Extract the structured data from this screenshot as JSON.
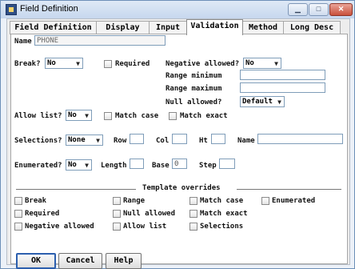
{
  "window": {
    "title": "Field Definition",
    "controls": [
      "minimize",
      "maximize",
      "close"
    ]
  },
  "tabs": [
    "Field Definition",
    "Display",
    "Input",
    "Validation",
    "Method",
    "Long Desc"
  ],
  "active_tab": "Validation",
  "name": {
    "label": "Name",
    "value": "PHONE"
  },
  "break": {
    "label": "Break?",
    "value": "No"
  },
  "required": {
    "label": "Required"
  },
  "negative_allowed": {
    "label": "Negative allowed?",
    "value": "No"
  },
  "range_minimum": {
    "label": "Range minimum",
    "value": ""
  },
  "range_maximum": {
    "label": "Range maximum",
    "value": ""
  },
  "null_allowed": {
    "label": "Null allowed?",
    "value": "Default"
  },
  "allow_list": {
    "label": "Allow list?",
    "value": "No"
  },
  "match_case": {
    "label": "Match case"
  },
  "match_exact": {
    "label": "Match exact"
  },
  "selections": {
    "label": "Selections?",
    "value": "None"
  },
  "row": {
    "label": "Row",
    "value": ""
  },
  "col": {
    "label": "Col",
    "value": ""
  },
  "ht": {
    "label": "Ht",
    "value": ""
  },
  "sel_name": {
    "label": "Name",
    "value": ""
  },
  "enumerated": {
    "label": "Enumerated?",
    "value": "No"
  },
  "length": {
    "label": "Length",
    "value": ""
  },
  "base": {
    "label": "Base",
    "value": "0"
  },
  "step": {
    "label": "Step",
    "value": ""
  },
  "template_overrides": {
    "title": "Template overrides",
    "items": [
      "Break",
      "Range",
      "Match case",
      "Enumerated",
      "Required",
      "Null allowed",
      "Match exact",
      "Negative allowed",
      "Allow list",
      "Selections"
    ]
  },
  "buttons": {
    "ok": "OK",
    "cancel": "Cancel",
    "help": "Help"
  }
}
